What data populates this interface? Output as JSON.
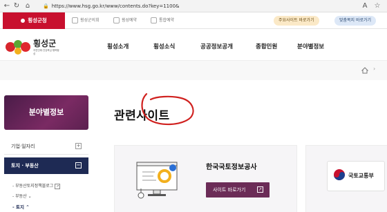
{
  "browser": {
    "url": "https://www.hsg.go.kr/www/contents.do?key=1100&"
  },
  "topstrip": {
    "gov_label": "횡성군청",
    "tabs": [
      "횡성군의회",
      "횡성예약",
      "통합예약"
    ],
    "btn_main_sites": "주요사이트 바로가기",
    "btn_welfare": "맞춤복지 바로가기"
  },
  "header": {
    "logo_name": "횡성군",
    "logo_sub": "자연인에·건강복심·행복횡성",
    "nav": [
      "횡성소개",
      "횡성소식",
      "공공정보공개",
      "종합민원",
      "분야별정보"
    ]
  },
  "sidebar": {
    "title": "분야별정보",
    "items": [
      {
        "label": "기업·일자리",
        "toggle": "+"
      },
      {
        "label": "토지 · 부동산",
        "toggle": "−"
      }
    ],
    "subitems": [
      "부동산토지정책블로그",
      "부동산",
      "토지"
    ]
  },
  "main": {
    "title": "관련사이트",
    "cards": [
      {
        "name": "한국국토정보공사",
        "button": "사이트 바로가기"
      },
      {
        "name": "국토교통부"
      }
    ]
  },
  "colors": {
    "gov_red": "#c8102e",
    "sidebar_active": "#1e2a54",
    "button_purple": "#6b2c57",
    "annotation_red": "#d0211f"
  }
}
